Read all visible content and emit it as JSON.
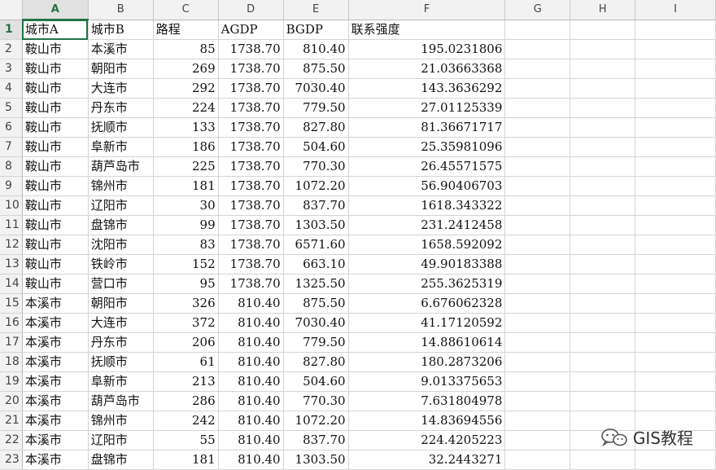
{
  "columns": [
    "A",
    "B",
    "C",
    "D",
    "E",
    "F",
    "G",
    "H",
    "I"
  ],
  "headers": [
    "城市A",
    "城市B",
    "路程",
    "AGDP",
    "BGDP",
    "联系强度"
  ],
  "rows": [
    {
      "n": "2",
      "a": "鞍山市",
      "b": "本溪市",
      "c": "85",
      "d": "1738.70",
      "e": "810.40",
      "f": "195.0231806"
    },
    {
      "n": "3",
      "a": "鞍山市",
      "b": "朝阳市",
      "c": "269",
      "d": "1738.70",
      "e": "875.50",
      "f": "21.03663368"
    },
    {
      "n": "4",
      "a": "鞍山市",
      "b": "大连市",
      "c": "292",
      "d": "1738.70",
      "e": "7030.40",
      "f": "143.3636292"
    },
    {
      "n": "5",
      "a": "鞍山市",
      "b": "丹东市",
      "c": "224",
      "d": "1738.70",
      "e": "779.50",
      "f": "27.01125339"
    },
    {
      "n": "6",
      "a": "鞍山市",
      "b": "抚顺市",
      "c": "133",
      "d": "1738.70",
      "e": "827.80",
      "f": "81.36671717"
    },
    {
      "n": "7",
      "a": "鞍山市",
      "b": "阜新市",
      "c": "186",
      "d": "1738.70",
      "e": "504.60",
      "f": "25.35981096"
    },
    {
      "n": "8",
      "a": "鞍山市",
      "b": "葫芦岛市",
      "c": "225",
      "d": "1738.70",
      "e": "770.30",
      "f": "26.45571575"
    },
    {
      "n": "9",
      "a": "鞍山市",
      "b": "锦州市",
      "c": "181",
      "d": "1738.70",
      "e": "1072.20",
      "f": "56.90406703"
    },
    {
      "n": "10",
      "a": "鞍山市",
      "b": "辽阳市",
      "c": "30",
      "d": "1738.70",
      "e": "837.70",
      "f": "1618.343322"
    },
    {
      "n": "11",
      "a": "鞍山市",
      "b": "盘锦市",
      "c": "99",
      "d": "1738.70",
      "e": "1303.50",
      "f": "231.2412458"
    },
    {
      "n": "12",
      "a": "鞍山市",
      "b": "沈阳市",
      "c": "83",
      "d": "1738.70",
      "e": "6571.60",
      "f": "1658.592092"
    },
    {
      "n": "13",
      "a": "鞍山市",
      "b": "铁岭市",
      "c": "152",
      "d": "1738.70",
      "e": "663.10",
      "f": "49.90183388"
    },
    {
      "n": "14",
      "a": "鞍山市",
      "b": "营口市",
      "c": "95",
      "d": "1738.70",
      "e": "1325.50",
      "f": "255.3625319"
    },
    {
      "n": "15",
      "a": "本溪市",
      "b": "朝阳市",
      "c": "326",
      "d": "810.40",
      "e": "875.50",
      "f": "6.676062328"
    },
    {
      "n": "16",
      "a": "本溪市",
      "b": "大连市",
      "c": "372",
      "d": "810.40",
      "e": "7030.40",
      "f": "41.17120592"
    },
    {
      "n": "17",
      "a": "本溪市",
      "b": "丹东市",
      "c": "206",
      "d": "810.40",
      "e": "779.50",
      "f": "14.88610614"
    },
    {
      "n": "18",
      "a": "本溪市",
      "b": "抚顺市",
      "c": "61",
      "d": "810.40",
      "e": "827.80",
      "f": "180.2873206"
    },
    {
      "n": "19",
      "a": "本溪市",
      "b": "阜新市",
      "c": "213",
      "d": "810.40",
      "e": "504.60",
      "f": "9.013375653"
    },
    {
      "n": "20",
      "a": "本溪市",
      "b": "葫芦岛市",
      "c": "286",
      "d": "810.40",
      "e": "770.30",
      "f": "7.631804978"
    },
    {
      "n": "21",
      "a": "本溪市",
      "b": "锦州市",
      "c": "242",
      "d": "810.40",
      "e": "1072.20",
      "f": "14.83694556"
    },
    {
      "n": "22",
      "a": "本溪市",
      "b": "辽阳市",
      "c": "55",
      "d": "810.40",
      "e": "837.70",
      "f": "224.4205223"
    },
    {
      "n": "23",
      "a": "本溪市",
      "b": "盘锦市",
      "c": "181",
      "d": "810.40",
      "e": "1303.50",
      "f": "32.2443271"
    }
  ],
  "watermark": "GIS教程",
  "watermark_icon": "wechat-icon",
  "accent_color": "#217346"
}
